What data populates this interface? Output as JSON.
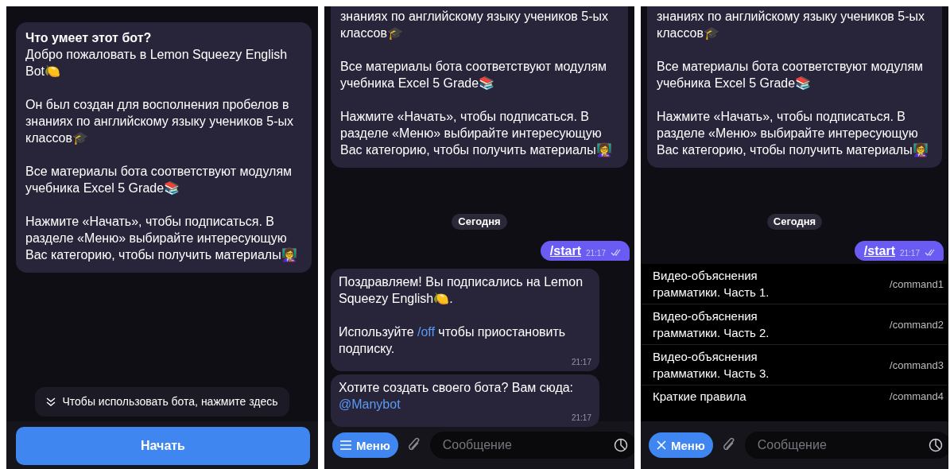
{
  "panels": [
    {
      "kind": "intro",
      "info_card": {
        "title": "Что умеет этот бот?",
        "paragraphs": [
          "Добро пожаловать в Lemon Squeezy English Bot🍋",
          "Он был создан для восполнения пробелов в знаниях по английскому языку учеников 5-ых классов🎓",
          "Все материалы бота соответствуют модулям учебника Excel 5 Grade📚",
          "Нажмите «Начать», чтобы подписаться. В разделе «Меню» выбирайте интересующую Вас категорию, чтобы получить материалы👩‍🏫"
        ]
      },
      "hint": "Чтобы использовать бота, нажмите здесь",
      "start_button": "Начать"
    },
    {
      "kind": "chat",
      "info_card": {
        "paragraphs": [
          "знаниях по английскому языку учеников 5-ых классов🎓",
          "Все материалы бота соответствуют модулям учебника Excel 5 Grade📚",
          "Нажмите «Начать», чтобы подписаться. В разделе «Меню» выбирайте интересующую Вас категорию, чтобы получить материалы👩‍🏫"
        ]
      },
      "date": "Сегодня",
      "outgoing": {
        "text": "/start",
        "time": "21:17"
      },
      "incoming": [
        {
          "paragraphs": [
            [
              {
                "kind": "text",
                "text": "Поздравляем! Вы подписались на Lemon Squeezy English🍋."
              }
            ],
            [
              {
                "kind": "text",
                "text": "Используйте "
              },
              {
                "kind": "link",
                "text": "/off"
              },
              {
                "kind": "text",
                "text": " чтобы приостановить подписку."
              }
            ]
          ],
          "time": "21:17"
        },
        {
          "paragraphs": [
            [
              {
                "kind": "text",
                "text": "Хотите создать своего бота? Вам сюда: "
              },
              {
                "kind": "link",
                "text": "@Manybot"
              }
            ]
          ],
          "time": "21:17"
        }
      ],
      "composer": {
        "menu_open": false,
        "menu_label": "Меню",
        "placeholder": "Сообщение"
      }
    },
    {
      "kind": "chat",
      "info_card": {
        "paragraphs": [
          "знаниях по английскому языку учеников 5-ых классов🎓",
          "Все материалы бота соответствуют модулям учебника Excel 5 Grade📚",
          "Нажмите «Начать», чтобы подписаться. В разделе «Меню» выбирайте интересующую Вас категорию, чтобы получить материалы👩‍🏫"
        ]
      },
      "date": "Сегодня",
      "outgoing": {
        "text": "/start",
        "time": "21:17"
      },
      "commands": [
        {
          "description": "Видео-объяснения грамматики. Часть 1.",
          "command": "/command1"
        },
        {
          "description": "Видео-объяснения грамматики. Часть 2.",
          "command": "/command2"
        },
        {
          "description": "Видео-объяснения грамматики. Часть 3.",
          "command": "/command3"
        },
        {
          "description": "Краткие правила",
          "command": "/command4"
        }
      ],
      "composer": {
        "menu_open": true,
        "menu_label": "Меню",
        "placeholder": "Сообщение"
      }
    }
  ]
}
